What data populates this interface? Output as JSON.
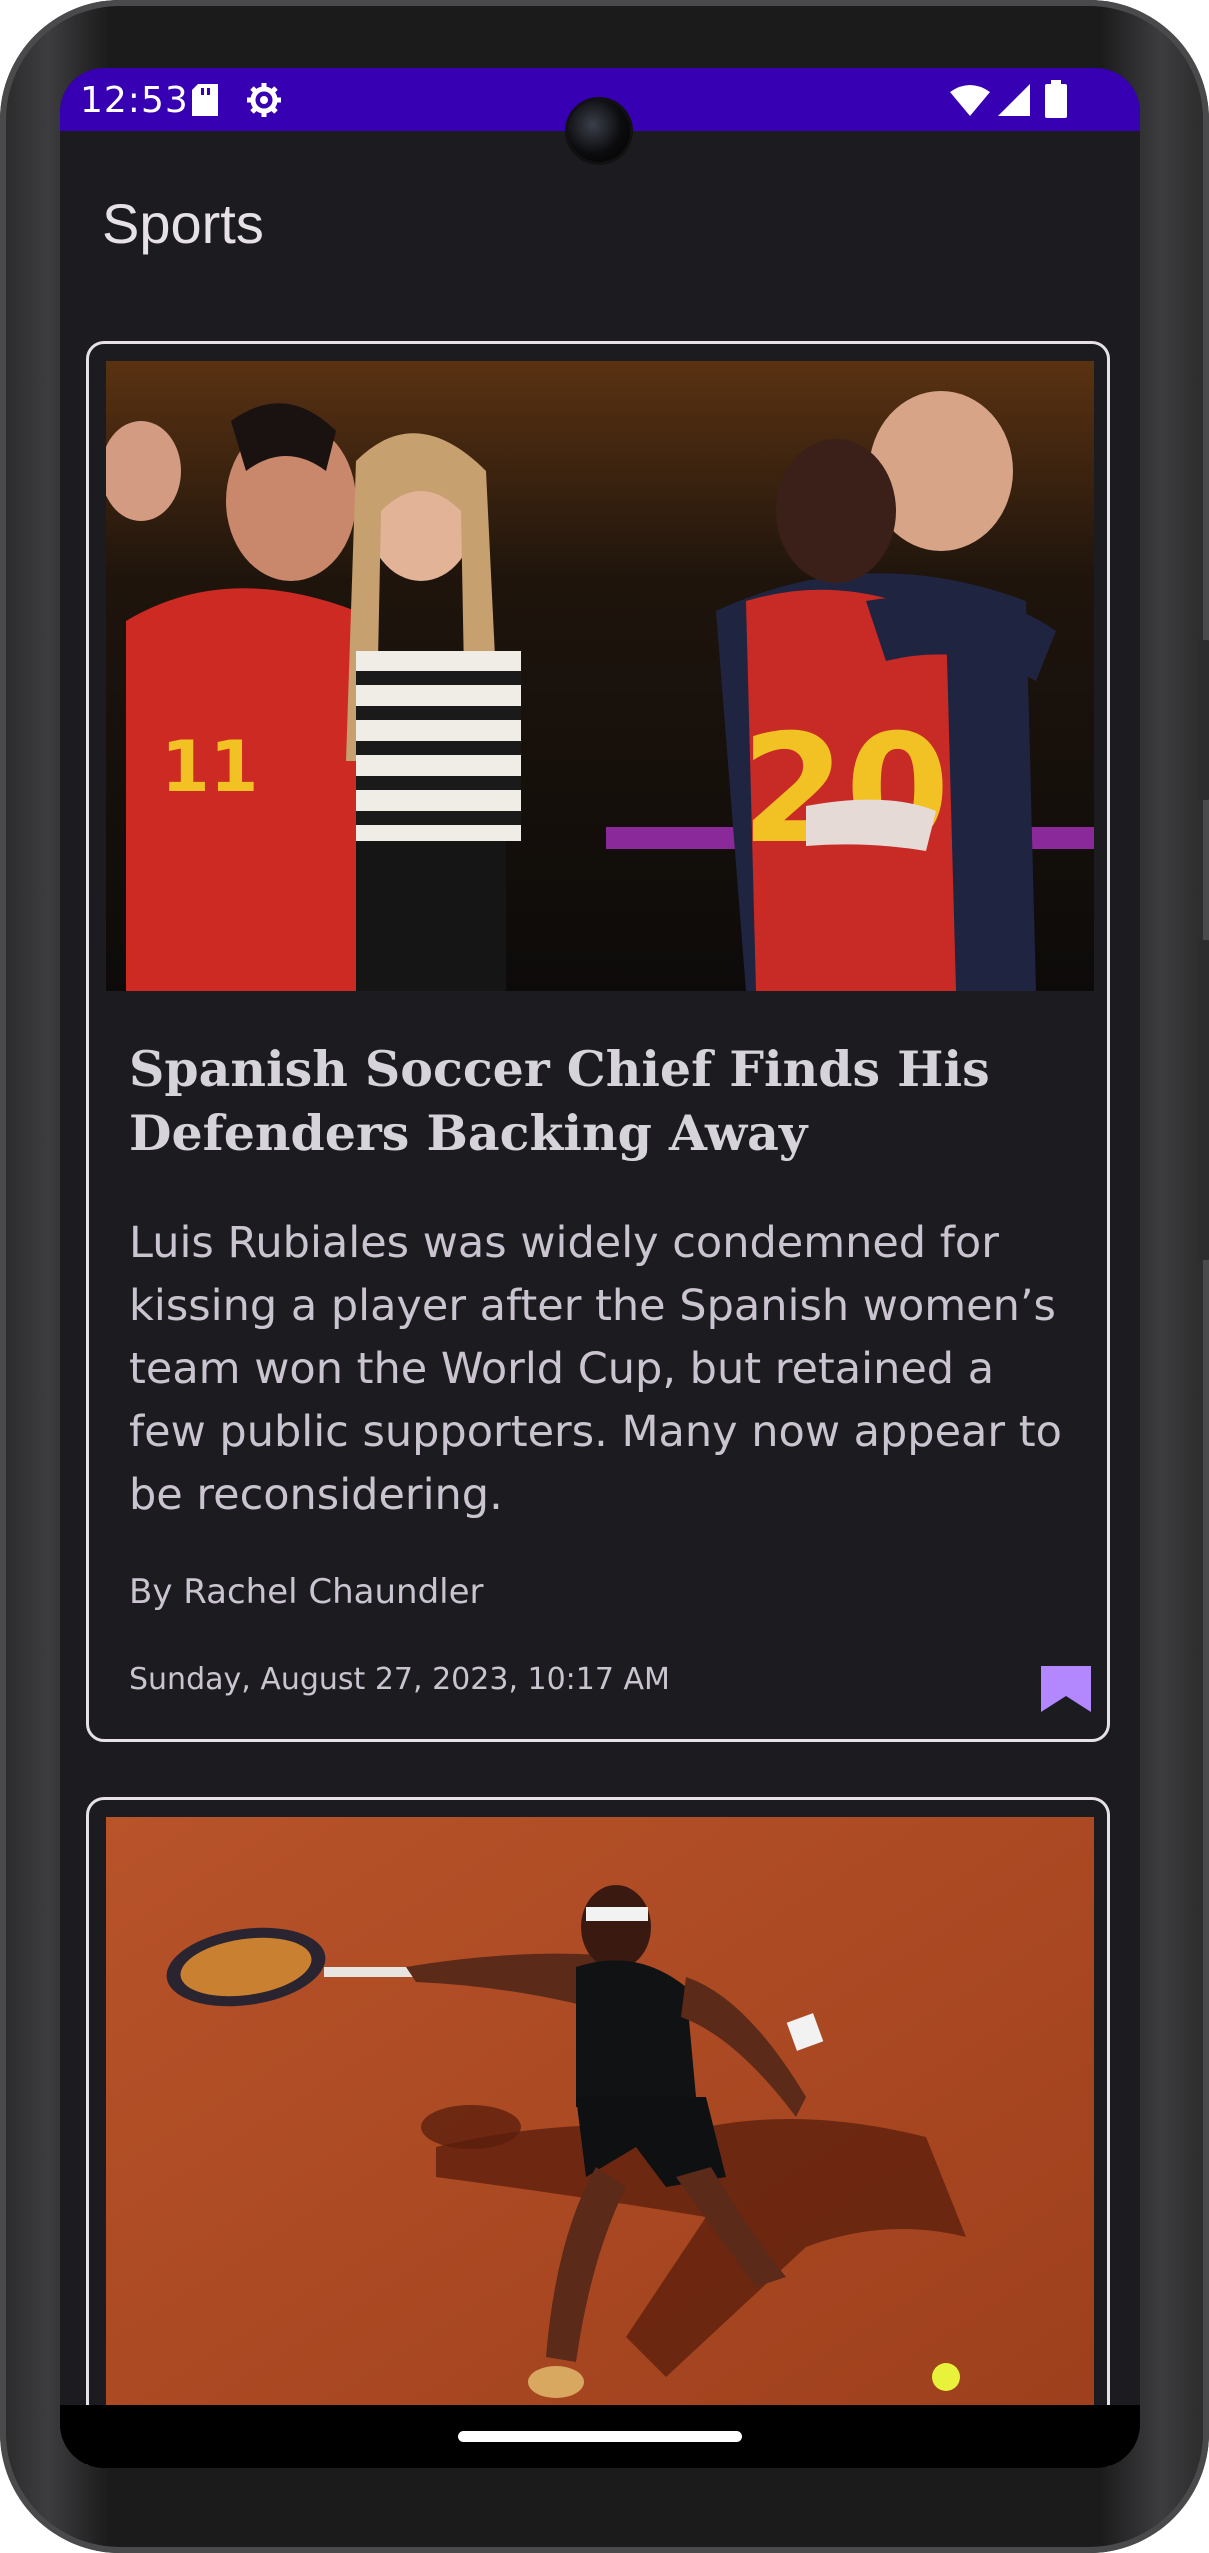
{
  "status_bar": {
    "time": "12:53",
    "background_color": "#3700b3",
    "left_icons": [
      "sd-card-icon",
      "settings-icon"
    ],
    "right_icons": [
      "wifi-icon",
      "signal-icon",
      "battery-icon"
    ]
  },
  "app_bar": {
    "title": "Sports"
  },
  "articles": [
    {
      "image_description_icon": "photo",
      "headline": "Spanish Soccer Chief Finds His Defenders Backing Away",
      "summary": "Luis Rubiales was widely condemned for kissing a player after the Spanish women’s team won the World Cup, but retained a few public supporters. Many now appear to be reconsidering.",
      "byline": "By Rachel Chaundler",
      "date": "Sunday, August 27, 2023, 10:17 AM",
      "bookmarked": true,
      "bookmark_color": "#b388ff"
    },
    {
      "image_description_icon": "photo"
    }
  ]
}
